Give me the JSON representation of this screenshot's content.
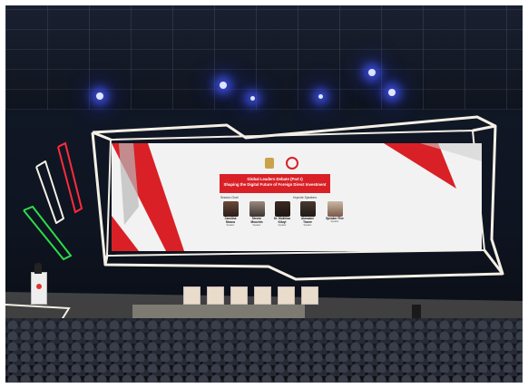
{
  "slide": {
    "title_line1": "Global Leaders Debate (Part I)",
    "title_line2": "Shaping the Digital Future of Foreign Direct Investment",
    "left_section": "Session Chair",
    "right_section": "Keynote Speakers"
  },
  "speakers": [
    {
      "name": "Carolina Mosca",
      "role": "Speaker"
    },
    {
      "name": "Steven Mnuchin",
      "role": "Speaker"
    },
    {
      "name": "Dr. Mukhisa Kituyi",
      "role": "Speaker"
    },
    {
      "name": "Alassane Traore",
      "role": "Speaker"
    },
    {
      "name": "Speaker Five",
      "role": "Speaker"
    }
  ],
  "colors": {
    "accent_red": "#d92027",
    "stage_light": "#f4efe4",
    "neon_red": "#ff2b3a",
    "neon_green": "#2bdc4a"
  }
}
